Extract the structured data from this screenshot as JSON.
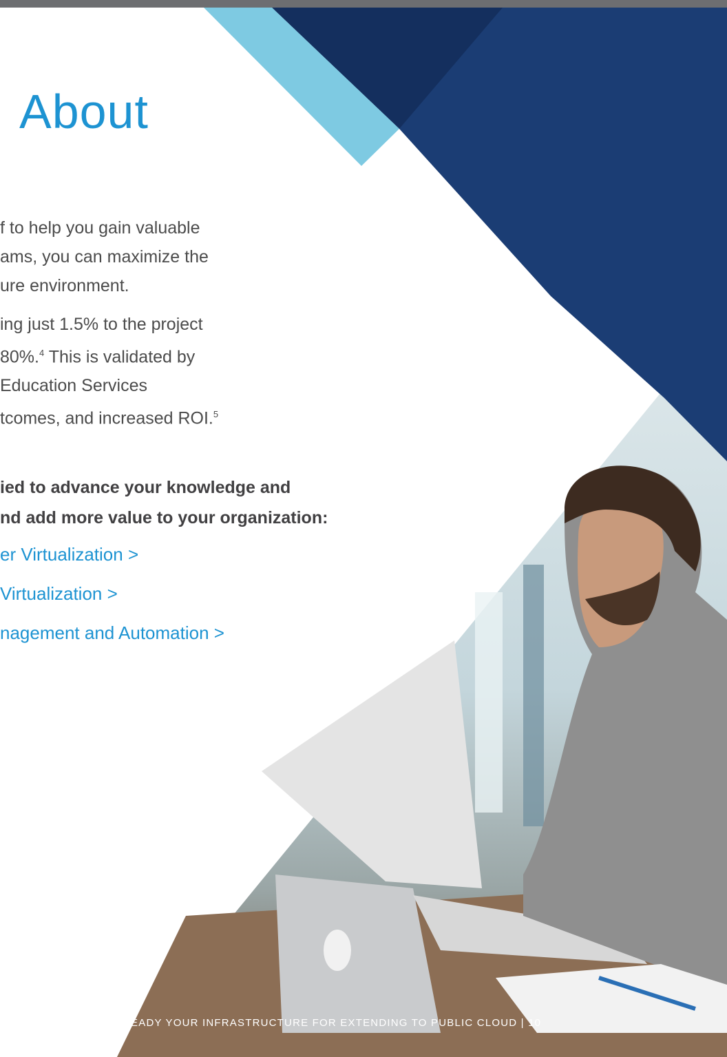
{
  "page_title": "About",
  "paragraph_1": [
    "f to help you gain valuable",
    "ams, you can maximize the",
    "ure environment."
  ],
  "paragraph_2": {
    "line_1": "ing just 1.5% to the project",
    "line_2_text": " 80%.",
    "line_2_note": "4",
    "line_2_rest": " This is validated by",
    "line_3": "Education Services",
    "line_4_text": "tcomes, and increased ROI.",
    "line_4_note": "5"
  },
  "lead_text": [
    "ied to advance your knowledge and",
    "nd add more value to your organization:"
  ],
  "links": [
    "er Virtualization >",
    "Virtualization >",
    "nagement and Automation >"
  ],
  "footer": "READY YOUR INFRASTRUCTURE FOR EXTENDING TO PUBLIC CLOUD | 10",
  "colors": {
    "accent_blue": "#1d93d2",
    "navy": "#1b3d74",
    "dark_navy": "#142f5e",
    "light_blue": "#7ecae2",
    "body_text": "#4b4b4b",
    "top_bar": "#6d6e71"
  }
}
